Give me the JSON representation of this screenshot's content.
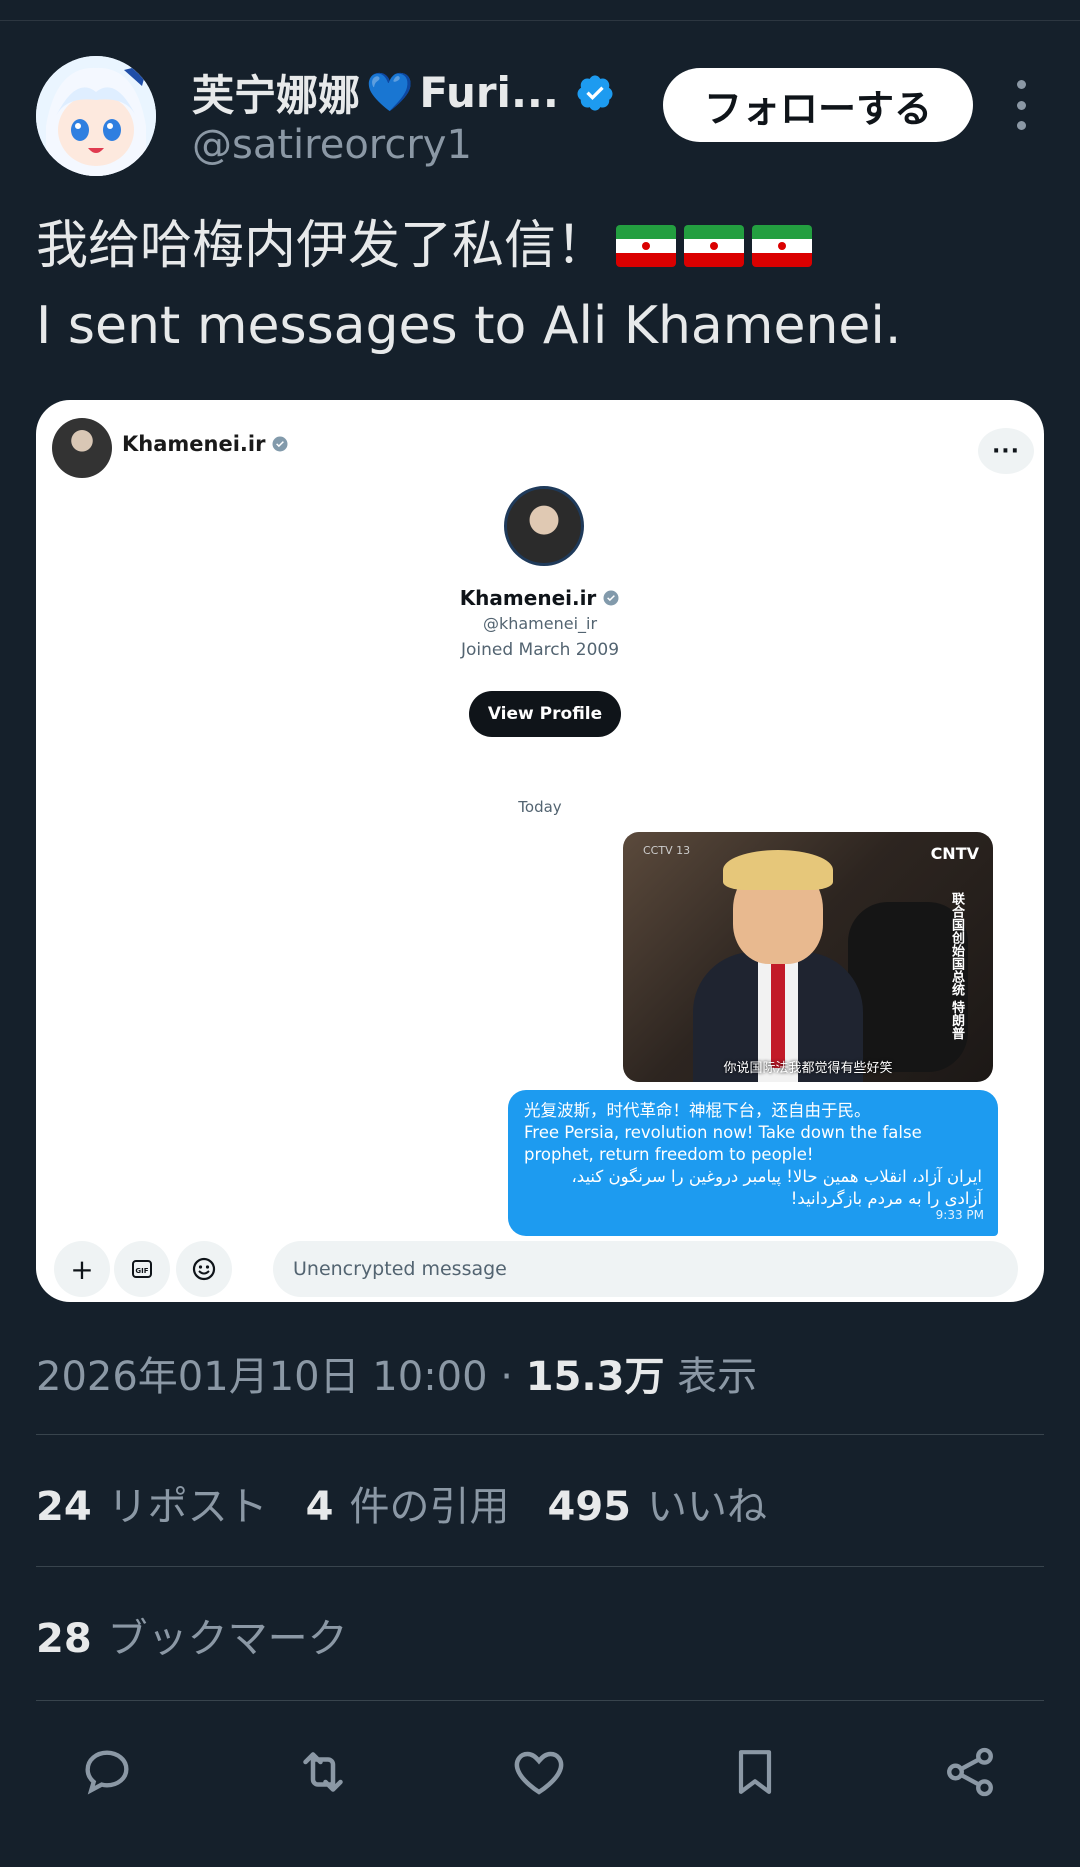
{
  "author": {
    "display_name": "芙宁娜娜",
    "display_name_suffix": "Furi...",
    "handle": "@satireorcry1",
    "follow_label": "フォローする"
  },
  "tweet": {
    "line1": "我给哈梅内伊发了私信！",
    "line2": "I sent messages to Ali Khamenei."
  },
  "dm": {
    "top_name": "Khamenei.ir",
    "profile_name": "Khamenei.ir",
    "profile_handle": "@khamenei_ir",
    "joined": "Joined March 2009",
    "view_profile_label": "View Profile",
    "date_divider": "Today",
    "image": {
      "logo": "CNTV",
      "channel": "CCTV 13",
      "vertical_caption": "联合国创始国总统 特朗普",
      "subtitle": "你说国际法我都觉得有些好笑"
    },
    "message": {
      "zh": "光复波斯，时代革命！神棍下台，还自由于民。",
      "en": "Free Persia, revolution now! Take down the false prophet, return freedom to people!",
      "fa1": "ایران آزاد، انقلاب همین حالا! پیامبر دروغین را سرنگون کنید،",
      "fa2": "آزادی را به مردم بازگردانید!",
      "time": "9:33 PM"
    },
    "composer_placeholder": "Unencrypted message"
  },
  "meta": {
    "timestamp": "2026年01月10日 10:00",
    "sep": " · ",
    "views_value": "15.3万",
    "views_label": "表示"
  },
  "stats": {
    "reposts_value": "24",
    "reposts_label": "リポスト",
    "quotes_value": "4",
    "quotes_label": "件の引用",
    "likes_value": "495",
    "likes_label": "いいね",
    "bookmarks_value": "28",
    "bookmarks_label": "ブックマーク"
  },
  "colors": {
    "background": "#15202b",
    "accent": "#1d9bf0",
    "muted": "#8b98a5"
  },
  "icons": [
    "heart-emoji-icon",
    "verified-icon",
    "more-icon",
    "iran-flag-icon",
    "plus-icon",
    "gif-icon",
    "emoji-icon",
    "reply-icon",
    "retweet-icon",
    "like-icon",
    "bookmark-icon",
    "share-icon"
  ]
}
